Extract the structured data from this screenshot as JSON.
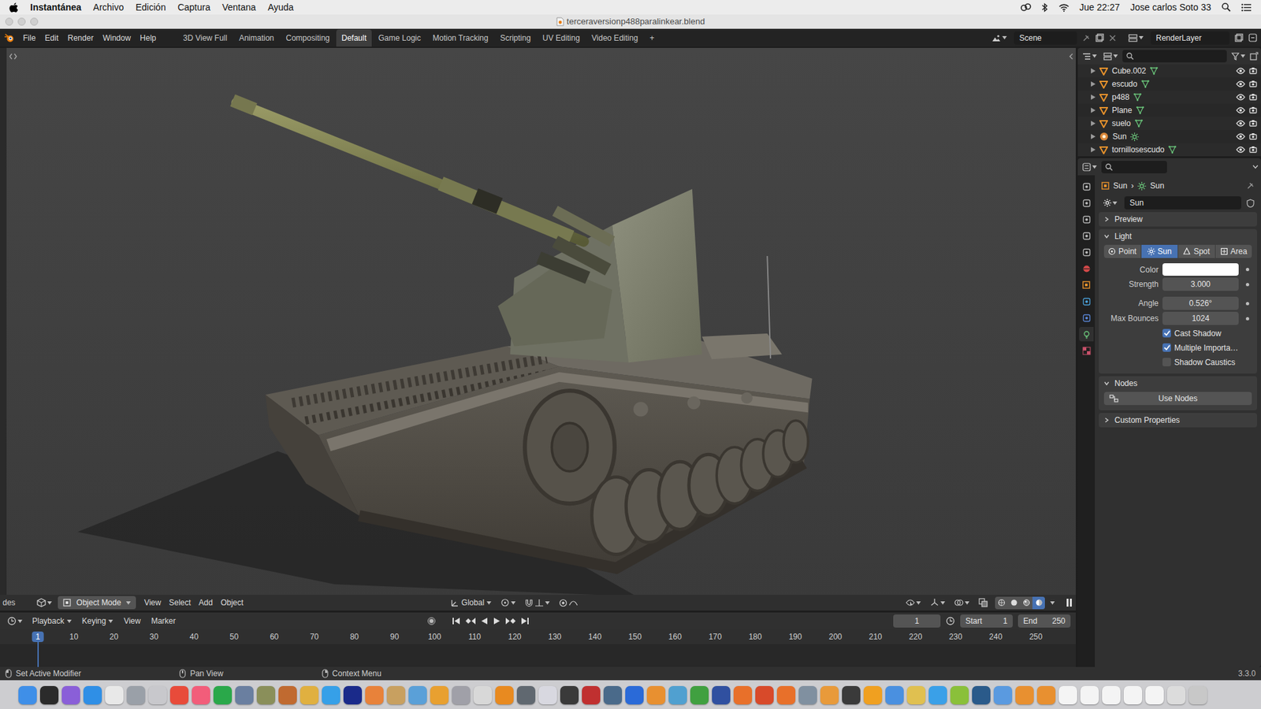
{
  "menubar": {
    "app": "Instantánea",
    "menus": [
      "Archivo",
      "Edición",
      "Captura",
      "Ventana",
      "Ayuda"
    ],
    "clock": "Jue 22:27",
    "user": "Jose carlos Soto 33"
  },
  "window": {
    "title": "terceraversionp488paralinkear.blend"
  },
  "topbar": {
    "menus": [
      "File",
      "Edit",
      "Render",
      "Window",
      "Help"
    ],
    "workspaces": [
      {
        "label": "3D View Full",
        "selected": false
      },
      {
        "label": "Animation",
        "selected": false
      },
      {
        "label": "Compositing",
        "selected": false
      },
      {
        "label": "Default",
        "selected": true
      },
      {
        "label": "Game Logic",
        "selected": false
      },
      {
        "label": "Motion Tracking",
        "selected": false
      },
      {
        "label": "Scripting",
        "selected": false
      },
      {
        "label": "UV Editing",
        "selected": false
      },
      {
        "label": "Video Editing",
        "selected": false
      }
    ],
    "add_tab": "+",
    "scene": "Scene",
    "view_layer": "RenderLayer"
  },
  "viewport": {
    "cut_label": "des",
    "mode": "Object Mode",
    "menus": [
      "View",
      "Select",
      "Add",
      "Object"
    ],
    "orientation": "Global",
    "shading": [
      {
        "selected": false
      },
      {
        "selected": false
      },
      {
        "selected": false
      },
      {
        "selected": true
      }
    ]
  },
  "outliner": {
    "items": [
      {
        "name": "Cube.002",
        "kind": "mesh",
        "visible": true,
        "renderable": true
      },
      {
        "name": "escudo",
        "kind": "mesh",
        "visible": true,
        "renderable": true
      },
      {
        "name": "p488",
        "kind": "mesh",
        "visible": true,
        "renderable": true
      },
      {
        "name": "Plane",
        "kind": "mesh",
        "visible": true,
        "renderable": true
      },
      {
        "name": "suelo",
        "kind": "mesh",
        "visible": true,
        "renderable": true
      },
      {
        "name": "Sun",
        "kind": "light",
        "visible": true,
        "renderable": true
      },
      {
        "name": "tornillosescudo",
        "kind": "mesh",
        "visible": true,
        "renderable": true
      }
    ]
  },
  "properties": {
    "tabs": [
      {
        "selected": false
      },
      {
        "selected": false
      },
      {
        "selected": false
      },
      {
        "selected": false
      },
      {
        "selected": false
      },
      {
        "selected": false
      },
      {
        "selected": false
      },
      {
        "selected": false
      },
      {
        "selected": false
      },
      {
        "selected": true
      },
      {
        "selected": false
      }
    ],
    "breadcrumb": [
      "Sun",
      "Sun"
    ],
    "separator": "›",
    "datablock": "Sun",
    "sections": [
      {
        "title": "Preview",
        "expanded": false
      },
      {
        "title": "Light",
        "expanded": true,
        "types": [
          {
            "label": "Point",
            "selected": false
          },
          {
            "label": "Sun",
            "selected": true
          },
          {
            "label": "Spot",
            "selected": false
          },
          {
            "label": "Area",
            "selected": false
          }
        ],
        "fields": [
          {
            "kind": "color",
            "label": "Color",
            "color": "#ffffff"
          },
          {
            "kind": "number",
            "label": "Strength",
            "value": "3.000"
          },
          {
            "kind": "number",
            "label": "Angle",
            "value": "0.526°"
          },
          {
            "kind": "number",
            "label": "Max Bounces",
            "value": "1024"
          },
          {
            "kind": "checkbox",
            "label": "Cast Shadow",
            "checked": true
          },
          {
            "kind": "checkbox",
            "label": "Multiple Importa…",
            "checked": true
          },
          {
            "kind": "checkbox",
            "label": "Shadow Caustics",
            "checked": false
          }
        ]
      },
      {
        "title": "Nodes",
        "expanded": true,
        "button": "Use Nodes"
      },
      {
        "title": "Custom Properties",
        "expanded": false
      }
    ]
  },
  "timeline": {
    "menus": [
      "Playback",
      "Keying",
      "View",
      "Marker"
    ],
    "frame": "1",
    "start_label": "Start",
    "start": "1",
    "end_label": "End",
    "end": "250",
    "ruler": [
      {
        "label": "1",
        "selected": true
      },
      {
        "label": "10",
        "selected": false
      },
      {
        "label": "20",
        "selected": false
      },
      {
        "label": "30",
        "selected": false
      },
      {
        "label": "40",
        "selected": false
      },
      {
        "label": "50",
        "selected": false
      },
      {
        "label": "60",
        "selected": false
      },
      {
        "label": "70",
        "selected": false
      },
      {
        "label": "80",
        "selected": false
      },
      {
        "label": "90",
        "selected": false
      },
      {
        "label": "100",
        "selected": false
      },
      {
        "label": "110",
        "selected": false
      },
      {
        "label": "120",
        "selected": false
      },
      {
        "label": "130",
        "selected": false
      },
      {
        "label": "140",
        "selected": false
      },
      {
        "label": "150",
        "selected": false
      },
      {
        "label": "160",
        "selected": false
      },
      {
        "label": "170",
        "selected": false
      },
      {
        "label": "180",
        "selected": false
      },
      {
        "label": "190",
        "selected": false
      },
      {
        "label": "200",
        "selected": false
      },
      {
        "label": "210",
        "selected": false
      },
      {
        "label": "220",
        "selected": false
      },
      {
        "label": "230",
        "selected": false
      },
      {
        "label": "240",
        "selected": false
      },
      {
        "label": "250",
        "selected": false
      }
    ]
  },
  "status_bar": {
    "items": [
      "Set Active Modifier",
      "Pan View",
      "Context Menu"
    ],
    "version": "3.3.0"
  }
}
